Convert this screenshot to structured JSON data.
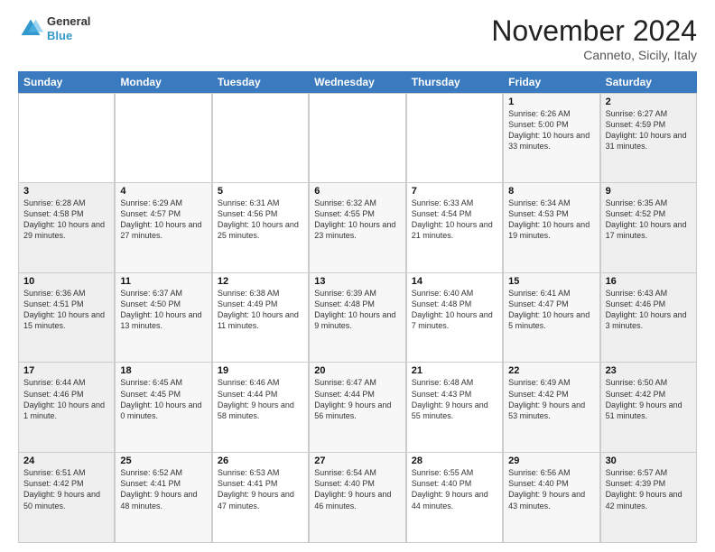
{
  "header": {
    "month_title": "November 2024",
    "location": "Canneto, Sicily, Italy",
    "logo_general": "General",
    "logo_blue": "Blue"
  },
  "weekdays": [
    "Sunday",
    "Monday",
    "Tuesday",
    "Wednesday",
    "Thursday",
    "Friday",
    "Saturday"
  ],
  "rows": [
    [
      {
        "day": "",
        "sunrise": "",
        "sunset": "",
        "daylight": "",
        "empty": true
      },
      {
        "day": "",
        "sunrise": "",
        "sunset": "",
        "daylight": "",
        "empty": true
      },
      {
        "day": "",
        "sunrise": "",
        "sunset": "",
        "daylight": "",
        "empty": true
      },
      {
        "day": "",
        "sunrise": "",
        "sunset": "",
        "daylight": "",
        "empty": true
      },
      {
        "day": "",
        "sunrise": "",
        "sunset": "",
        "daylight": "",
        "empty": true
      },
      {
        "day": "1",
        "sunrise": "Sunrise: 6:26 AM",
        "sunset": "Sunset: 5:00 PM",
        "daylight": "Daylight: 10 hours and 33 minutes."
      },
      {
        "day": "2",
        "sunrise": "Sunrise: 6:27 AM",
        "sunset": "Sunset: 4:59 PM",
        "daylight": "Daylight: 10 hours and 31 minutes."
      }
    ],
    [
      {
        "day": "3",
        "sunrise": "Sunrise: 6:28 AM",
        "sunset": "Sunset: 4:58 PM",
        "daylight": "Daylight: 10 hours and 29 minutes."
      },
      {
        "day": "4",
        "sunrise": "Sunrise: 6:29 AM",
        "sunset": "Sunset: 4:57 PM",
        "daylight": "Daylight: 10 hours and 27 minutes."
      },
      {
        "day": "5",
        "sunrise": "Sunrise: 6:31 AM",
        "sunset": "Sunset: 4:56 PM",
        "daylight": "Daylight: 10 hours and 25 minutes."
      },
      {
        "day": "6",
        "sunrise": "Sunrise: 6:32 AM",
        "sunset": "Sunset: 4:55 PM",
        "daylight": "Daylight: 10 hours and 23 minutes."
      },
      {
        "day": "7",
        "sunrise": "Sunrise: 6:33 AM",
        "sunset": "Sunset: 4:54 PM",
        "daylight": "Daylight: 10 hours and 21 minutes."
      },
      {
        "day": "8",
        "sunrise": "Sunrise: 6:34 AM",
        "sunset": "Sunset: 4:53 PM",
        "daylight": "Daylight: 10 hours and 19 minutes."
      },
      {
        "day": "9",
        "sunrise": "Sunrise: 6:35 AM",
        "sunset": "Sunset: 4:52 PM",
        "daylight": "Daylight: 10 hours and 17 minutes."
      }
    ],
    [
      {
        "day": "10",
        "sunrise": "Sunrise: 6:36 AM",
        "sunset": "Sunset: 4:51 PM",
        "daylight": "Daylight: 10 hours and 15 minutes."
      },
      {
        "day": "11",
        "sunrise": "Sunrise: 6:37 AM",
        "sunset": "Sunset: 4:50 PM",
        "daylight": "Daylight: 10 hours and 13 minutes."
      },
      {
        "day": "12",
        "sunrise": "Sunrise: 6:38 AM",
        "sunset": "Sunset: 4:49 PM",
        "daylight": "Daylight: 10 hours and 11 minutes."
      },
      {
        "day": "13",
        "sunrise": "Sunrise: 6:39 AM",
        "sunset": "Sunset: 4:48 PM",
        "daylight": "Daylight: 10 hours and 9 minutes."
      },
      {
        "day": "14",
        "sunrise": "Sunrise: 6:40 AM",
        "sunset": "Sunset: 4:48 PM",
        "daylight": "Daylight: 10 hours and 7 minutes."
      },
      {
        "day": "15",
        "sunrise": "Sunrise: 6:41 AM",
        "sunset": "Sunset: 4:47 PM",
        "daylight": "Daylight: 10 hours and 5 minutes."
      },
      {
        "day": "16",
        "sunrise": "Sunrise: 6:43 AM",
        "sunset": "Sunset: 4:46 PM",
        "daylight": "Daylight: 10 hours and 3 minutes."
      }
    ],
    [
      {
        "day": "17",
        "sunrise": "Sunrise: 6:44 AM",
        "sunset": "Sunset: 4:46 PM",
        "daylight": "Daylight: 10 hours and 1 minute."
      },
      {
        "day": "18",
        "sunrise": "Sunrise: 6:45 AM",
        "sunset": "Sunset: 4:45 PM",
        "daylight": "Daylight: 10 hours and 0 minutes."
      },
      {
        "day": "19",
        "sunrise": "Sunrise: 6:46 AM",
        "sunset": "Sunset: 4:44 PM",
        "daylight": "Daylight: 9 hours and 58 minutes."
      },
      {
        "day": "20",
        "sunrise": "Sunrise: 6:47 AM",
        "sunset": "Sunset: 4:44 PM",
        "daylight": "Daylight: 9 hours and 56 minutes."
      },
      {
        "day": "21",
        "sunrise": "Sunrise: 6:48 AM",
        "sunset": "Sunset: 4:43 PM",
        "daylight": "Daylight: 9 hours and 55 minutes."
      },
      {
        "day": "22",
        "sunrise": "Sunrise: 6:49 AM",
        "sunset": "Sunset: 4:42 PM",
        "daylight": "Daylight: 9 hours and 53 minutes."
      },
      {
        "day": "23",
        "sunrise": "Sunrise: 6:50 AM",
        "sunset": "Sunset: 4:42 PM",
        "daylight": "Daylight: 9 hours and 51 minutes."
      }
    ],
    [
      {
        "day": "24",
        "sunrise": "Sunrise: 6:51 AM",
        "sunset": "Sunset: 4:42 PM",
        "daylight": "Daylight: 9 hours and 50 minutes."
      },
      {
        "day": "25",
        "sunrise": "Sunrise: 6:52 AM",
        "sunset": "Sunset: 4:41 PM",
        "daylight": "Daylight: 9 hours and 48 minutes."
      },
      {
        "day": "26",
        "sunrise": "Sunrise: 6:53 AM",
        "sunset": "Sunset: 4:41 PM",
        "daylight": "Daylight: 9 hours and 47 minutes."
      },
      {
        "day": "27",
        "sunrise": "Sunrise: 6:54 AM",
        "sunset": "Sunset: 4:40 PM",
        "daylight": "Daylight: 9 hours and 46 minutes."
      },
      {
        "day": "28",
        "sunrise": "Sunrise: 6:55 AM",
        "sunset": "Sunset: 4:40 PM",
        "daylight": "Daylight: 9 hours and 44 minutes."
      },
      {
        "day": "29",
        "sunrise": "Sunrise: 6:56 AM",
        "sunset": "Sunset: 4:40 PM",
        "daylight": "Daylight: 9 hours and 43 minutes."
      },
      {
        "day": "30",
        "sunrise": "Sunrise: 6:57 AM",
        "sunset": "Sunset: 4:39 PM",
        "daylight": "Daylight: 9 hours and 42 minutes."
      }
    ]
  ]
}
